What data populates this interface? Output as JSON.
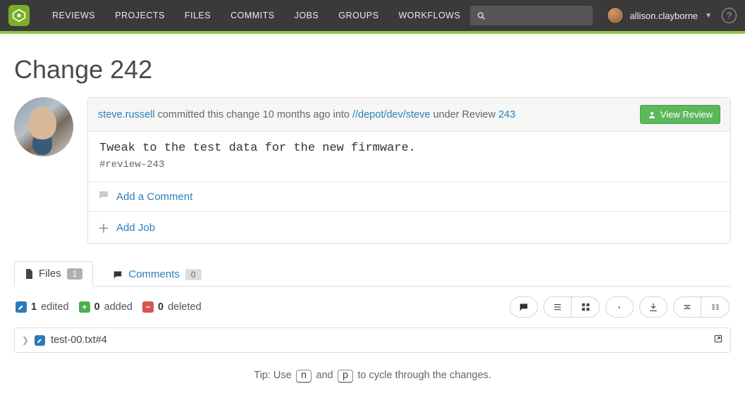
{
  "nav": {
    "items": [
      "REVIEWS",
      "PROJECTS",
      "FILES",
      "COMMITS",
      "JOBS",
      "GROUPS",
      "WORKFLOWS"
    ],
    "search_placeholder": "",
    "user_name": "allison.clayborne"
  },
  "page": {
    "title": "Change 242"
  },
  "header": {
    "author": "steve.russell",
    "committed_text_1": " committed this change ",
    "time_ago": "10 months ago",
    "committed_text_2": " into ",
    "depot_path": "//depot/dev/steve",
    "under_review_text": " under Review ",
    "review_id": "243",
    "view_review_label": "View Review"
  },
  "description": {
    "main": "Tweak to the test data for the new firmware.",
    "tag": "#review-243"
  },
  "actions": {
    "add_comment": "Add a Comment",
    "add_job": "Add Job"
  },
  "tabs": {
    "files_label": "Files",
    "files_count": "1",
    "comments_label": "Comments",
    "comments_count": "0"
  },
  "stats": {
    "edited_count": "1",
    "edited_label": "edited",
    "added_count": "0",
    "added_label": "added",
    "deleted_count": "0",
    "deleted_label": "deleted"
  },
  "file": {
    "name": "test-00.txt#4"
  },
  "tip": {
    "prefix": "Tip: Use ",
    "key1": "n",
    "mid": " and ",
    "key2": "p",
    "suffix": " to cycle through the changes."
  }
}
